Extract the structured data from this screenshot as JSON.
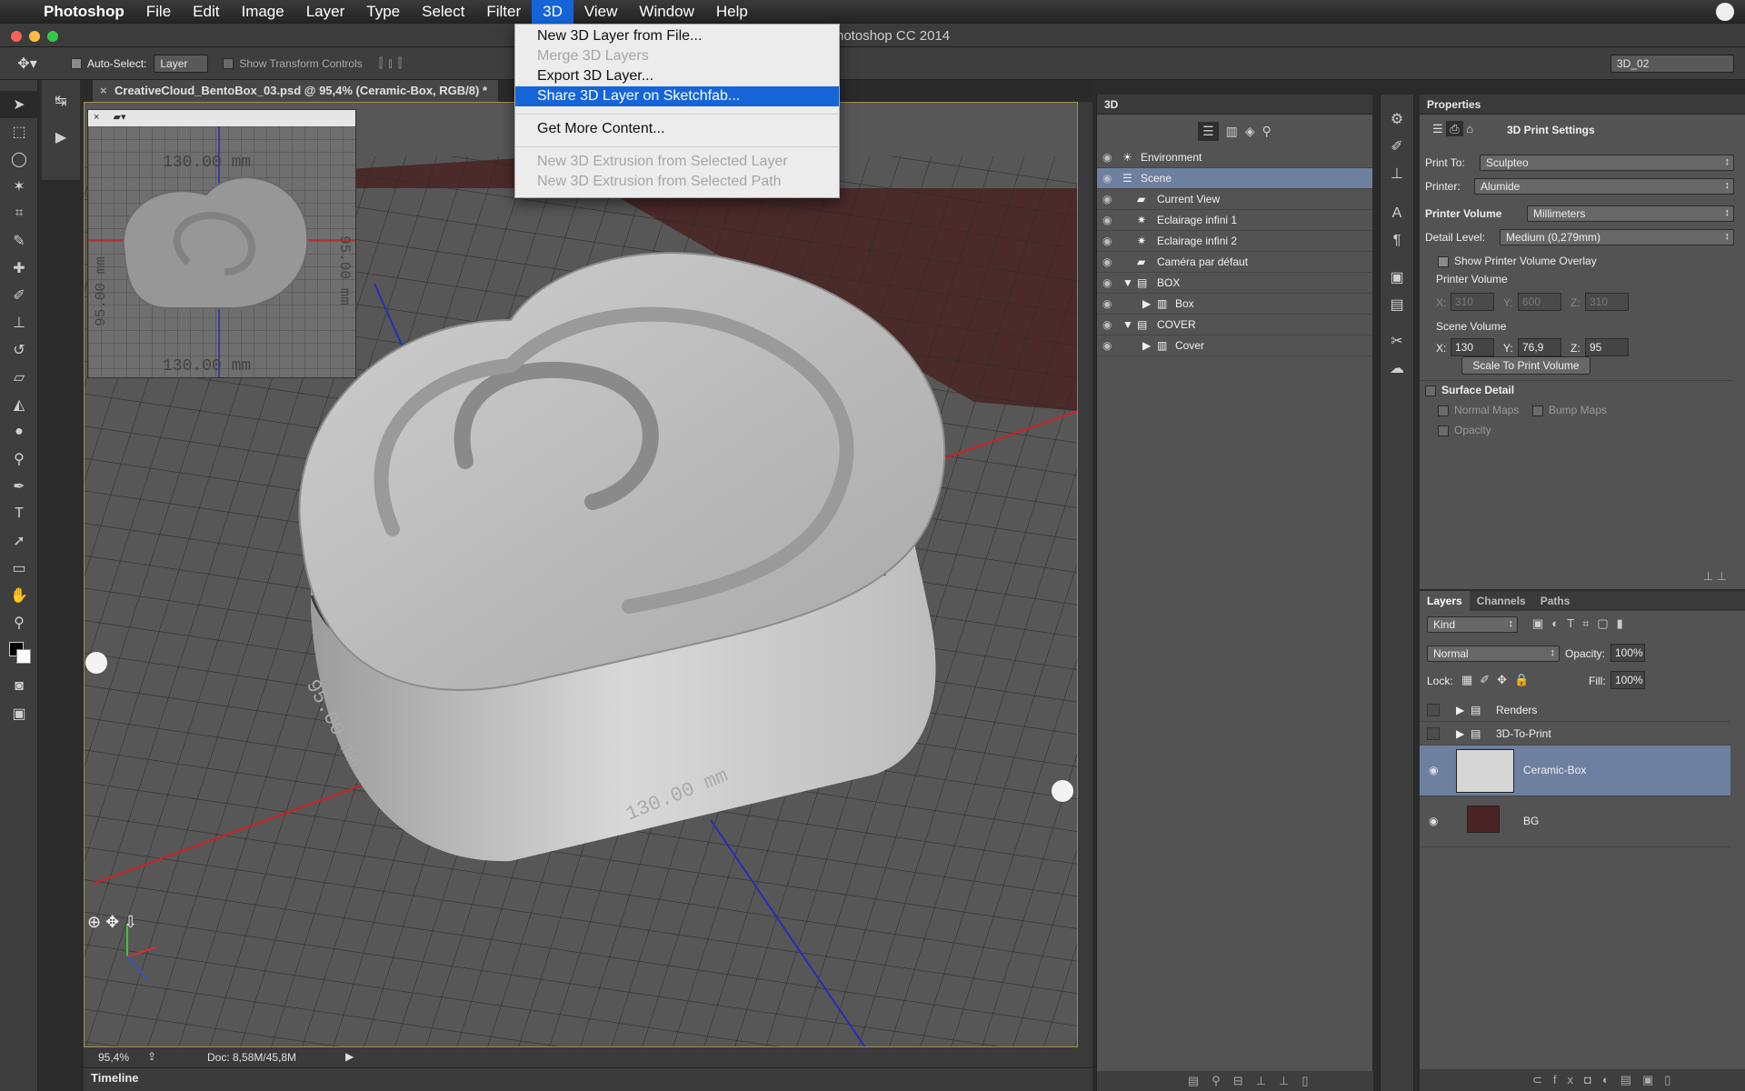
{
  "menubar": {
    "app_name": "Photoshop",
    "items": [
      "File",
      "Edit",
      "Image",
      "Layer",
      "Type",
      "Select",
      "Filter",
      "3D",
      "View",
      "Window",
      "Help"
    ],
    "active": "3D"
  },
  "window": {
    "title": "hotoshop CC 2014"
  },
  "options_bar": {
    "auto_select_label": "Auto-Select:",
    "auto_select_value": "Layer",
    "show_transform_label": "Show Transform Controls",
    "workspace_value": "3D_02"
  },
  "document": {
    "tab_title": "CreativeCloud_BentoBox_03.psd @ 95,4% (Ceramic-Box, RGB/8) *",
    "zoom": "95,4%",
    "doc_info": "Doc: 8,58M/45,8M"
  },
  "canvas_labels": {
    "width_dim": "130.00 mm",
    "depth_dim": "95.00 mm",
    "mini_top": "130.00 mm",
    "mini_bottom": "130.00 mm",
    "mini_left": "95.00 mm",
    "mini_right": "95.00 mm",
    "mini_side_left": "mm",
    "mini_side_right": "mm"
  },
  "menu_3d": {
    "items": [
      {
        "label": "New 3D Layer from File...",
        "state": "enabled"
      },
      {
        "label": "Merge 3D Layers",
        "state": "disabled"
      },
      {
        "label": "Export 3D Layer...",
        "state": "enabled"
      },
      {
        "label": "Share 3D Layer on Sketchfab...",
        "state": "highlighted"
      },
      {
        "label": "Get More Content...",
        "state": "enabled"
      },
      {
        "label": "New 3D Extrusion from Selected Layer",
        "state": "disabled"
      },
      {
        "label": "New 3D Extrusion from Selected Path",
        "state": "disabled"
      }
    ]
  },
  "panel_3d": {
    "title": "3D",
    "items": [
      {
        "label": "Environment",
        "icon": "environment-icon"
      },
      {
        "label": "Scene",
        "icon": "scene-icon",
        "selected": true
      },
      {
        "label": "Current View",
        "icon": "camera-icon"
      },
      {
        "label": "Eclairage infini 1",
        "icon": "light-icon"
      },
      {
        "label": "Eclairage infini 2",
        "icon": "light-icon"
      },
      {
        "label": "Caméra par défaut",
        "icon": "camera-icon"
      },
      {
        "label": "BOX",
        "icon": "folder-icon",
        "group": true
      },
      {
        "label": "Box",
        "icon": "mesh-icon"
      },
      {
        "label": "COVER",
        "icon": "folder-icon",
        "group": true
      },
      {
        "label": "Cover",
        "icon": "mesh-icon"
      }
    ]
  },
  "properties": {
    "title": "Properties",
    "section": "3D Print Settings",
    "print_to_label": "Print To:",
    "print_to_value": "Sculpteo",
    "printer_label": "Printer:",
    "printer_value": "Alumide",
    "printer_volume_label": "Printer Volume",
    "printer_volume_units": "Millimeters",
    "detail_level_label": "Detail Level:",
    "detail_level_value": "Medium (0,279mm)",
    "show_overlay_label": "Show Printer Volume Overlay",
    "show_overlay_checked": true,
    "printer_volume_sub": "Printer Volume",
    "printer_volume_xyz": [
      "310",
      "600",
      "310"
    ],
    "scene_volume_label": "Scene Volume",
    "scene_volume_xyz": [
      "130",
      "76,9",
      "95"
    ],
    "axis_labels": [
      "X:",
      "Y:",
      "Z:"
    ],
    "scale_button": "Scale To Print Volume",
    "surface_detail_label": "Surface Detail",
    "normal_maps_label": "Normal Maps",
    "bump_maps_label": "Bump Maps",
    "opacity_label": "Opacity"
  },
  "layers_panel": {
    "tabs": [
      "Layers",
      "Channels",
      "Paths"
    ],
    "kind_filter": "Kind",
    "blend_mode": "Normal",
    "opacity_label": "Opacity:",
    "opacity_value": "100%",
    "lock_label": "Lock:",
    "fill_label": "Fill:",
    "fill_value": "100%",
    "layers": [
      {
        "name": "Renders",
        "type": "group",
        "visible": false
      },
      {
        "name": "3D-To-Print",
        "type": "group",
        "visible": false
      },
      {
        "name": "Ceramic-Box",
        "type": "3d",
        "visible": true,
        "selected": true
      },
      {
        "name": "BG",
        "type": "pixel",
        "visible": true,
        "color": "#4a2424"
      }
    ]
  },
  "timeline": {
    "label": "Timeline"
  },
  "colors": {
    "menu_highlight": "#1665d8",
    "scene_selected": "#6e80a0",
    "layer_selected": "#6e80a0",
    "bg_layer": "#4a2424"
  }
}
